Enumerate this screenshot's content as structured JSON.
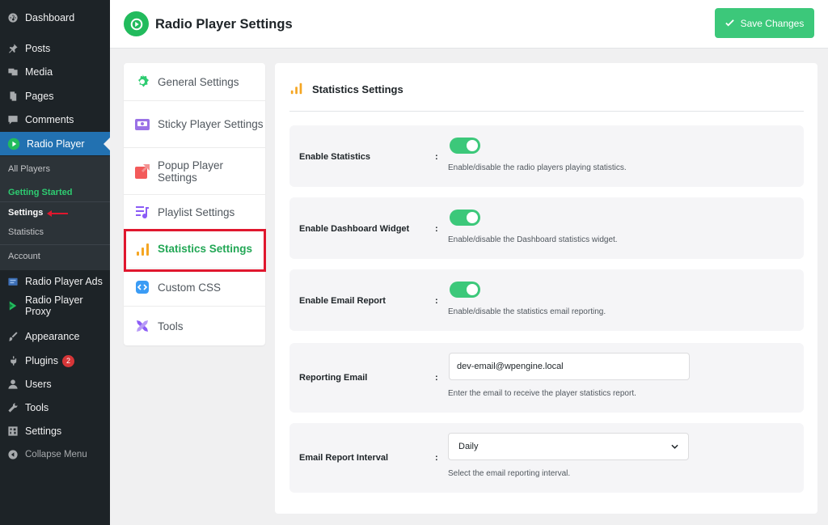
{
  "wp_menu": {
    "dashboard": "Dashboard",
    "posts": "Posts",
    "media": "Media",
    "pages": "Pages",
    "comments": "Comments",
    "radio_player": "Radio Player",
    "submenu": {
      "all_players": "All Players",
      "getting_started": "Getting Started",
      "settings": "Settings",
      "statistics": "Statistics",
      "account": "Account"
    },
    "radio_player_ads": "Radio Player Ads",
    "radio_player_proxy": "Radio Player Proxy",
    "appearance": "Appearance",
    "plugins": "Plugins",
    "plugins_badge": "2",
    "users": "Users",
    "tools": "Tools",
    "settings": "Settings",
    "collapse": "Collapse Menu"
  },
  "header": {
    "title": "Radio Player Settings",
    "save_label": "Save Changes"
  },
  "settings_nav": {
    "items": [
      {
        "label": "General Settings",
        "icon": "gear-icon"
      },
      {
        "label": "Sticky Player Settings",
        "icon": "sticky-player-icon"
      },
      {
        "label": "Popup Player Settings",
        "icon": "popup-icon"
      },
      {
        "label": "Playlist Settings",
        "icon": "playlist-icon"
      },
      {
        "label": "Statistics Settings",
        "icon": "bar-chart-icon"
      },
      {
        "label": "Custom CSS",
        "icon": "code-icon"
      },
      {
        "label": "Tools",
        "icon": "tools-icon"
      }
    ],
    "active_index": 4
  },
  "main": {
    "title": "Statistics Settings",
    "rows": [
      {
        "label": "Enable Statistics",
        "colon": ":",
        "enabled": true,
        "description": "Enable/disable the radio players playing statistics."
      },
      {
        "label": "Enable Dashboard Widget",
        "colon": ":",
        "enabled": true,
        "description": "Enable/disable the Dashboard statistics widget."
      },
      {
        "label": "Enable Email Report",
        "colon": ":",
        "enabled": true,
        "description": "Enable/disable the statistics email reporting."
      },
      {
        "label": "Reporting Email",
        "colon": ":",
        "value": "dev-email@wpengine.local",
        "description": "Enter the email to receive the player statistics report."
      },
      {
        "label": "Email Report Interval",
        "colon": ":",
        "selected": "Daily",
        "description": "Select the email reporting interval."
      }
    ]
  },
  "colors": {
    "accent_green": "#3cc87a",
    "wp_active_blue": "#2271b1",
    "highlight_red": "#e0172e",
    "sidebar_bg": "#1d2327"
  }
}
